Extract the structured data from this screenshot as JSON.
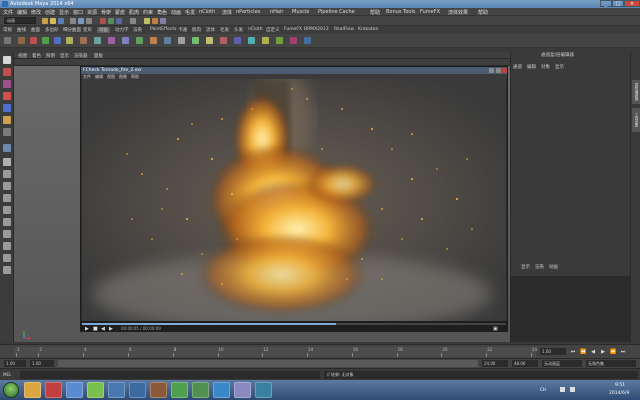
{
  "window": {
    "title": "Autodesk Maya 2014 x64"
  },
  "menubar": {
    "items": [
      "文件",
      "编辑",
      "修改",
      "创建",
      "显示",
      "窗口",
      "资源",
      "骨架",
      "蒙皮",
      "肌肉",
      "约束",
      "角色",
      "动画",
      "毛发",
      "nCloth",
      "流体",
      "nParticles",
      "nHair",
      "Muscle",
      "Pipeline Cache",
      "帮助",
      "Bonus Tools",
      "FumeFX",
      "流体效果",
      "帮助"
    ]
  },
  "statusline": {
    "mode": "动画"
  },
  "shelf": {
    "tabs": [
      "常规",
      "曲线",
      "曲面",
      "多边形",
      "细分曲面",
      "变形",
      "动画",
      "动力学",
      "渲染",
      "PaintEffects",
      "卡通",
      "肌肉",
      "流体",
      "毛发",
      "头发",
      "nCloth",
      "自定义",
      "FumeFX",
      "BRMX2013",
      "RealFlow",
      "Krakatoa"
    ],
    "active": "动画"
  },
  "panel": {
    "menus": [
      "视图",
      "着色",
      "照明",
      "显示",
      "渲染器",
      "面板"
    ]
  },
  "fcheck": {
    "title": "FCheck  Tornado_fire_2.exr",
    "menu": [
      "文件",
      "编辑",
      "视图",
      "图像",
      "帮助"
    ],
    "frame_label": "00:00:05 / 00:00:09",
    "progress": 0.6
  },
  "rightpanel": {
    "title": "通道盒/层编辑器",
    "tabs": [
      "通道",
      "编辑",
      "对象",
      "显示"
    ],
    "lower_tabs": [
      "显示",
      "渲染",
      "动画"
    ],
    "side_tabs": [
      "属性编辑器",
      "工具设置"
    ]
  },
  "timeslider": {
    "ticks": [
      "1",
      "2",
      "4",
      "6",
      "8",
      "10",
      "12",
      "14",
      "16",
      "18",
      "20",
      "22",
      "24"
    ],
    "current": "1.00",
    "playback_buttons": [
      "⏮",
      "⏪",
      "◀",
      "▶",
      "⏩",
      "⏭"
    ]
  },
  "rangeslider": {
    "start": "1.00",
    "inner_start": "1.00",
    "inner_end": "24.00",
    "end": "48.00",
    "anim_layer": "无动画层",
    "char_set": "无角色集"
  },
  "cmdline": {
    "mel_label": "MEL",
    "result": "// 结果: 无对象"
  },
  "taskbar": {
    "time": "9:51",
    "date": "2014/6/9",
    "lang": "CH"
  }
}
